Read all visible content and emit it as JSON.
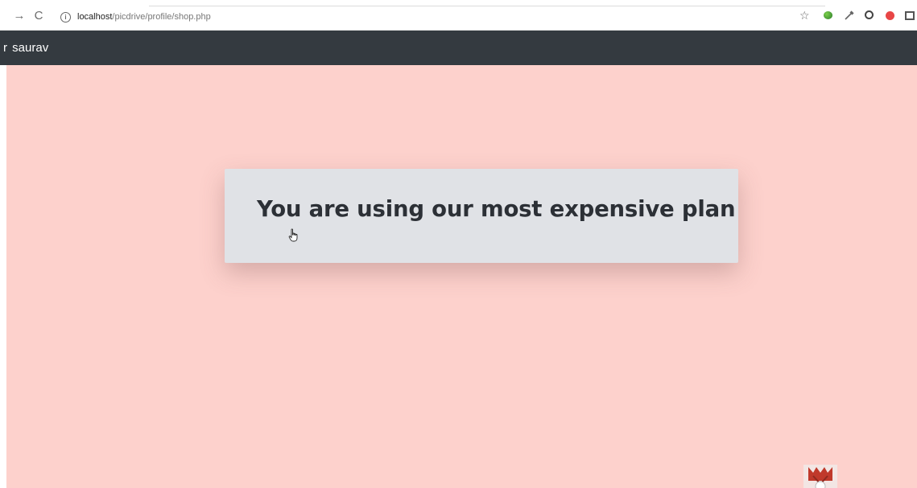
{
  "browser": {
    "back_icon": "→",
    "reload_icon": "C",
    "info_icon": "i",
    "url_host": "localhost",
    "url_path": "/picdrive/profile/shop.php",
    "star_icon": "☆",
    "extensions": [
      "green-extension-icon",
      "eyedropper-icon",
      "swirl-extension-icon",
      "red-extension-icon",
      "square-extension-icon"
    ]
  },
  "navbar": {
    "brand_prefix": "r",
    "username": "saurav",
    "background": "#343a40"
  },
  "page": {
    "background": "#fdd1cc",
    "card_background": "#e0e2e6",
    "message": "You are using our most expensive plan"
  }
}
